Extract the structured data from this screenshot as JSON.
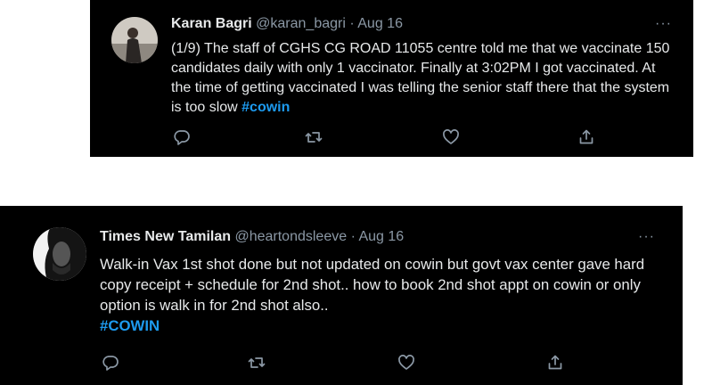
{
  "tweets": [
    {
      "name": "Karan Bagri",
      "handle": "@karan_bagri",
      "separator": "·",
      "date": "Aug 16",
      "more": "···",
      "text": "(1/9) The staff of CGHS CG ROAD 11055 centre told me that we vaccinate 150 candidates daily with only 1 vaccinator. Finally at 3:02PM I got vaccinated. At the time of getting vaccinated I was telling the senior staff there that the system is too slow",
      "hashtag": "#cowin"
    },
    {
      "name": "Times New Tamilan",
      "handle": "@heartondsleeve",
      "separator": "·",
      "date": "Aug 16",
      "more": "···",
      "text": "Walk-in Vax 1st shot done but not updated on cowin but govt vax center gave hard copy receipt + schedule for 2nd shot.. how to book 2nd shot appt on cowin or only option is walk in for 2nd shot also..",
      "hashtag": "#COWIN"
    }
  ],
  "icons": [
    "reply-icon",
    "retweet-icon",
    "like-icon",
    "share-icon"
  ],
  "colors": {
    "background": "#000000",
    "text": "#e7e9ea",
    "muted": "#8b98a5",
    "link": "#1d9bf0"
  }
}
